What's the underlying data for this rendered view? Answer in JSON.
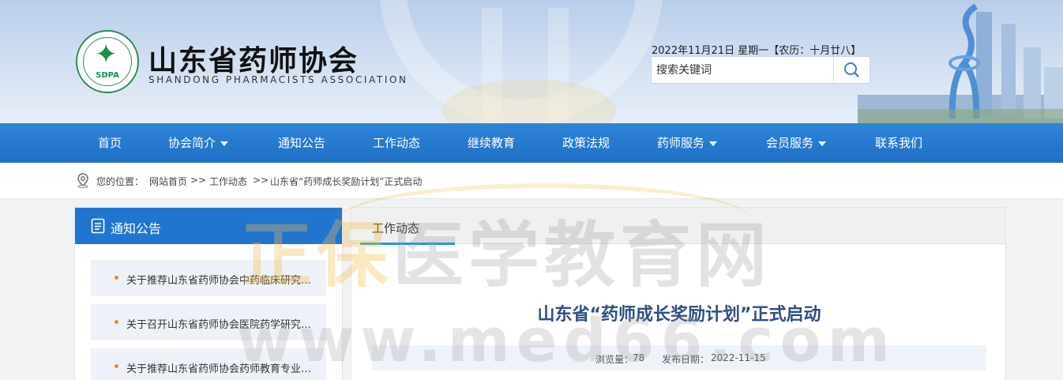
{
  "header": {
    "title": "山东省药师协会",
    "subtitle": "SHANDONG PHARMACISTS ASSOCIATION",
    "logo_text": "SDPA",
    "date": "2022年11月21日 星期一【农历：十月廿八】",
    "search_placeholder": "搜索关键词"
  },
  "nav": {
    "items": [
      {
        "label": "首页",
        "dropdown": false
      },
      {
        "label": "协会简介",
        "dropdown": true
      },
      {
        "label": "通知公告",
        "dropdown": false
      },
      {
        "label": "工作动态",
        "dropdown": false
      },
      {
        "label": "继续教育",
        "dropdown": false
      },
      {
        "label": "政策法规",
        "dropdown": false
      },
      {
        "label": "药师服务",
        "dropdown": true
      },
      {
        "label": "会员服务",
        "dropdown": true
      },
      {
        "label": "联系我们",
        "dropdown": false
      }
    ]
  },
  "breadcrumb": {
    "prefix": "您的位置：",
    "home": "网站首页",
    "sep1": ">>",
    "section": "工作动态",
    "sep2": ">>",
    "current": "山东省“药师成长奖励计划”正式启动"
  },
  "sidebar": {
    "title": "通知公告",
    "items": [
      {
        "label": "关于推荐山东省药师协会中药临床研究专业委员会委员的通知"
      },
      {
        "label": "关于召开山东省药师协会医院药学研究专业委员会会议的通知"
      },
      {
        "label": "关于推荐山东省药师协会药师教育专业委员会委员的通知"
      }
    ]
  },
  "main": {
    "tab": "工作动态",
    "article_title": "山东省“药师成长奖励计划”正式启动",
    "views_label": "浏览量：",
    "views": "78",
    "date_label": "发布日期：",
    "date": "2022-11-15"
  },
  "watermark": {
    "brand_gold": "正保",
    "brand_gray": "医学教育网",
    "url": "www.med66.com"
  },
  "colors": {
    "nav_blue": "#1f6fc5",
    "sidebar_blue": "#2175cf",
    "title_blue": "#2e4f82",
    "dot_orange": "#e8892c",
    "logo_green": "#14904a"
  }
}
